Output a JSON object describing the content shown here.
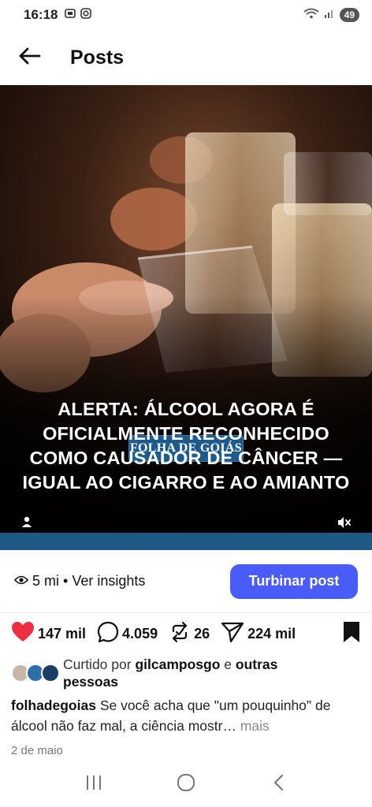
{
  "status_bar": {
    "time": "16:18",
    "battery": "49",
    "icons": [
      "screenshot-icon",
      "instagram-icon",
      "wifi-icon",
      "signal-icon"
    ]
  },
  "header": {
    "title": "Posts",
    "back_icon": "arrow-left-icon"
  },
  "media": {
    "brand": "FOLHA DE GOIÁS",
    "headline": "ALERTA: ÁLCOOL AGORA É OFICIALMENTE RECONHECIDO COMO CAUSADOR DE CÂNCER — IGUAL AO CIGARRO E AO AMIANTO",
    "user_icon": "person-icon",
    "mute_icon": "volume-muted-icon"
  },
  "insights": {
    "views": "5 mi",
    "separator": "•",
    "link": "Ver insights",
    "boost_label": "Turbinar post"
  },
  "actions": {
    "likes": "147 mil",
    "comments": "4.059",
    "reposts": "26",
    "shares": "224 mil"
  },
  "liked_by": {
    "prefix": "Curtido por",
    "user": "gilcamposgo",
    "middle": "e",
    "others": "outras",
    "suffix": "pessoas"
  },
  "caption": {
    "username": "folhadegoias",
    "text": "Se você acha que \"um pouquinho\" de álcool não faz mal, a ciência mostr…",
    "more": "mais"
  },
  "date": "2 de maio",
  "colors": {
    "boost": "#4a5cf7",
    "like": "#ed2f44",
    "brand_badge": "#1e5a8c"
  }
}
